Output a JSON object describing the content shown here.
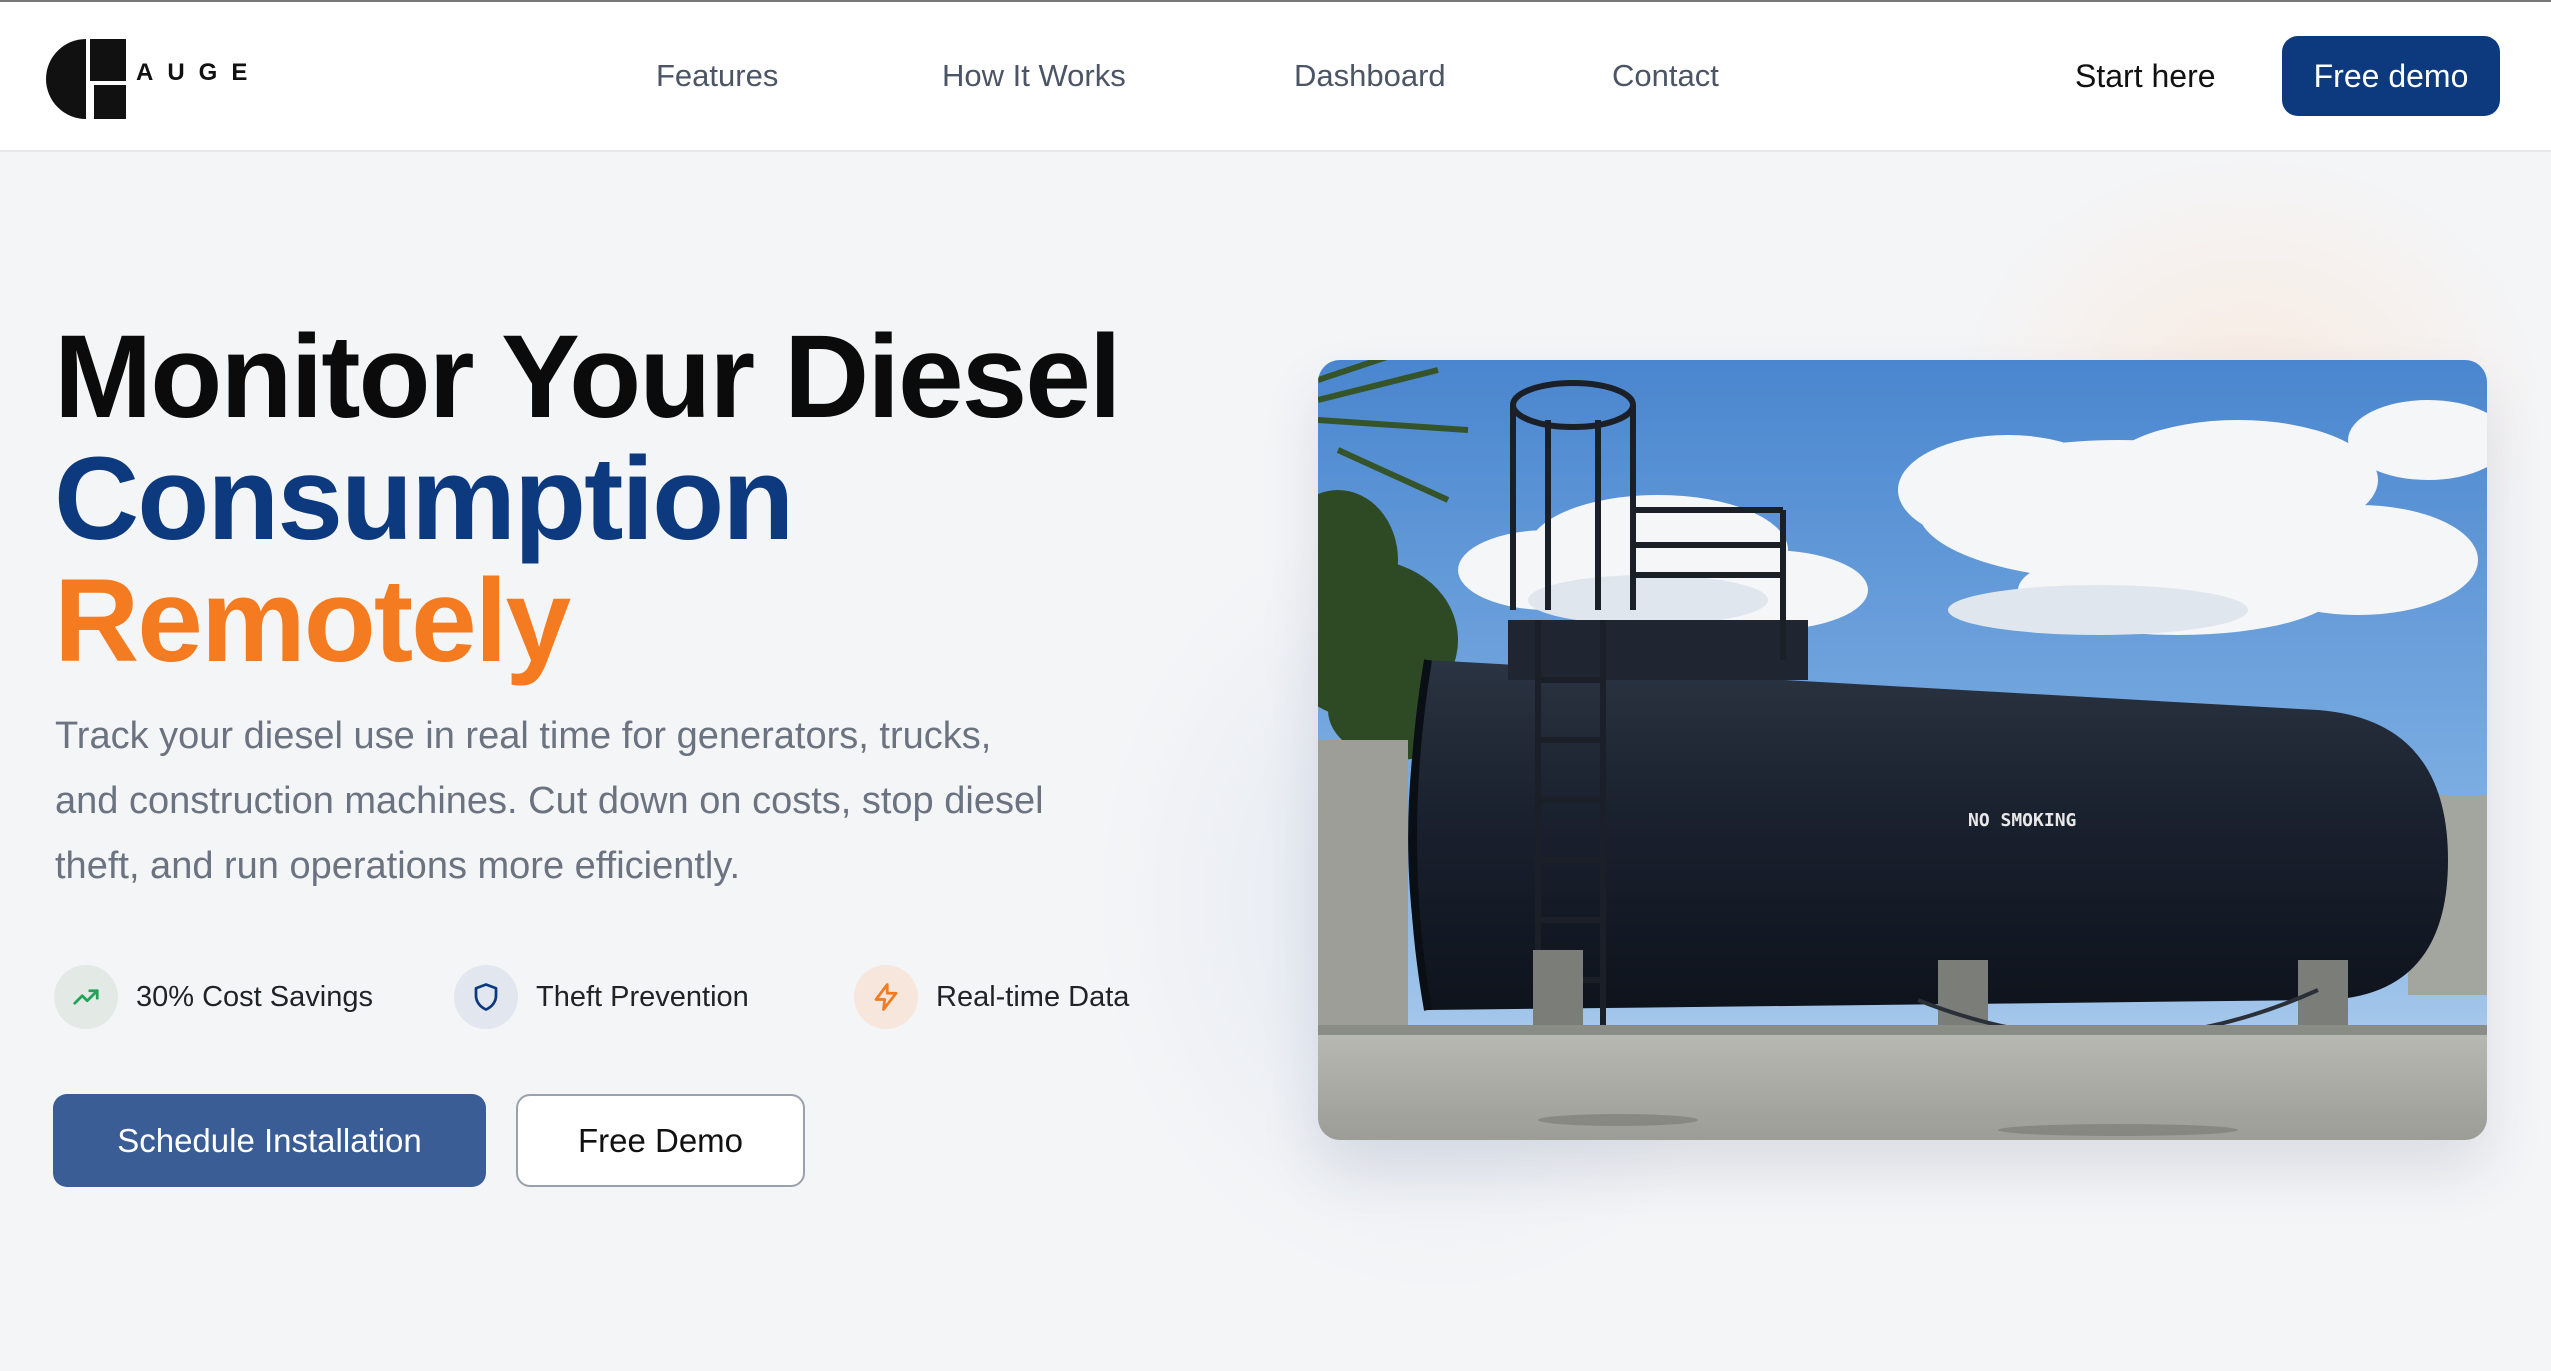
{
  "header": {
    "logo_text": "AUGE",
    "nav": [
      {
        "label": "Features"
      },
      {
        "label": "How It Works"
      },
      {
        "label": "Dashboard"
      },
      {
        "label": "Contact"
      }
    ],
    "start_here_label": "Start here",
    "free_demo_label": "Free demo"
  },
  "hero": {
    "headline_line1": "Monitor Your Diesel",
    "headline_line2": "Consumption",
    "headline_line3": "Remotely",
    "description": "Track your diesel use in real time for generators, trucks, and construction machines. Cut down on costs, stop diesel theft, and run operations more efficiently.",
    "features": [
      {
        "label": "30% Cost Savings",
        "icon": "trending-up-icon"
      },
      {
        "label": "Theft Prevention",
        "icon": "shield-icon"
      },
      {
        "label": "Real-time Data",
        "icon": "lightning-icon"
      }
    ],
    "schedule_label": "Schedule Installation",
    "demo_label": "Free Demo",
    "image_text": "NO SMOKING"
  },
  "colors": {
    "navy": "#0d3a7e",
    "orange": "#f47b20",
    "button_blue": "#3b5d95",
    "green_icon": "#22a35a"
  }
}
